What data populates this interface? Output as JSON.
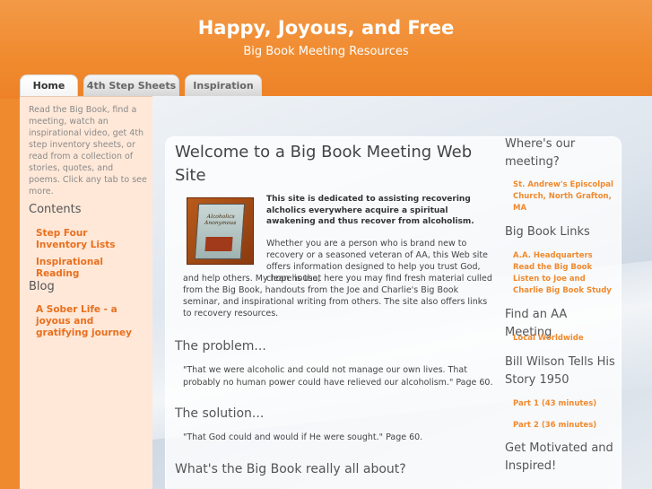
{
  "site": {
    "title": "Happy, Joyous, and Free",
    "subtitle": "Big Book Meeting Resources"
  },
  "tabs": [
    {
      "label": "Home",
      "active": true
    },
    {
      "label": "4th Step Sheets",
      "active": false
    },
    {
      "label": "Inspiration",
      "active": false
    }
  ],
  "left": {
    "intro": "Read the Big Book, find a meeting, watch an inspirational video, get 4th step inventory sheets, or read from a collection of stories, quotes, and poems. Click any tab to see more.",
    "contents_heading": "Contents",
    "contents_links": [
      "Step Four Inventory Lists",
      "Inspirational Reading"
    ],
    "blog_heading": "Blog",
    "blog_links": [
      "A Sober Life - a joyous and gratifying journey"
    ]
  },
  "main": {
    "title": "Welcome to a Big Book Meeting Web Site",
    "book_cover_text": "Alcoholics Anonymous",
    "intro_bold": "This site is dedicated to assisting recovering alcholics everywhere acquire a spiritual awakening and thus recover from alcoholism.",
    "intro_p1": "Whether you are a person who is brand new to recovery or a seasoned veteran of AA, this Web site offers information designed to help you trust God, clean house,",
    "intro_p2": "and help others. My hope is that here you may find fresh material culled from the Big Book, handouts from the Joe and Charlie's Big Book seminar, and inspirational writing from others. The site also offers links to recovery resources.",
    "problem_heading": "The problem...",
    "problem_quote": "\"That we were alcoholic and could not manage our own lives. That probably no human power could have relieved our alcoholism.\" Page 60.",
    "solution_heading": "The solution...",
    "solution_quote": "\"That God could and would if He were sought.\" Page 60.",
    "about_heading": "What's the Big Book really all about?"
  },
  "right": {
    "meeting_heading": "Where's our meeting?",
    "meeting_link": "St. Andrew's Episcolpal Church, North Grafton, MA",
    "links_heading": "Big Book Links",
    "links_text": "A.A. Headquarters Read the Big Book Listen to Joe and Charlie Big Book Study",
    "find_heading": "Find an AA Meeting",
    "find_link": "Local Worldwide",
    "wilson_heading": "Bill Wilson Tells His Story 1950",
    "wilson_parts": [
      "Part 1 (43 minutes)",
      "Part 2 (36 minutes)"
    ],
    "motivated_heading": "Get Motivated and Inspired!"
  },
  "colors": {
    "brand_orange": "#f08a2e",
    "link_orange": "#e8701e",
    "left_panel_bg": "#ffe8d8"
  }
}
